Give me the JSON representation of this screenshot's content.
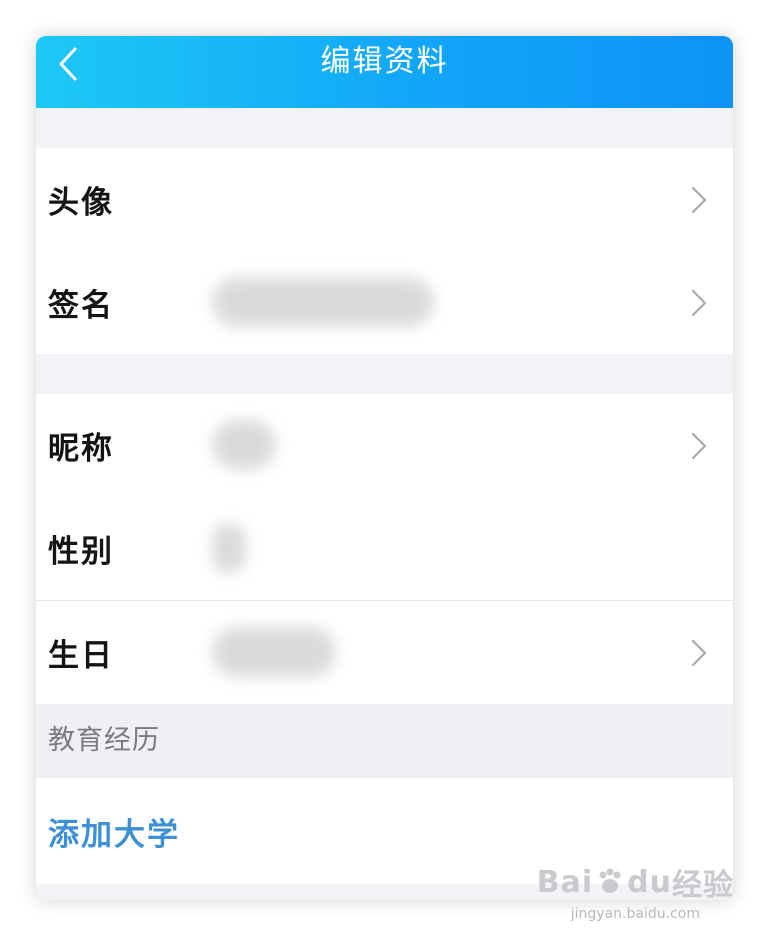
{
  "header": {
    "title": "编辑资料",
    "back_icon": "chevron-left-icon",
    "background_colors": [
      "#1ec8f5",
      "#0e93f7"
    ]
  },
  "profile": {
    "rows": [
      {
        "label": "头像",
        "has_chevron": true
      },
      {
        "label": "签名",
        "has_chevron": true
      }
    ]
  },
  "basic_info": {
    "rows": [
      {
        "label": "昵称",
        "has_chevron": true
      },
      {
        "label": "性别",
        "has_chevron": false
      },
      {
        "label": "生日",
        "has_chevron": true
      }
    ]
  },
  "education": {
    "section_title": "教育经历",
    "add_label": "添加大学",
    "link_color": "#3d8fd6"
  },
  "watermark": {
    "brand": "Bai",
    "brand2": "du",
    "suffix": "经验",
    "url": "jingyan.baidu.com"
  }
}
